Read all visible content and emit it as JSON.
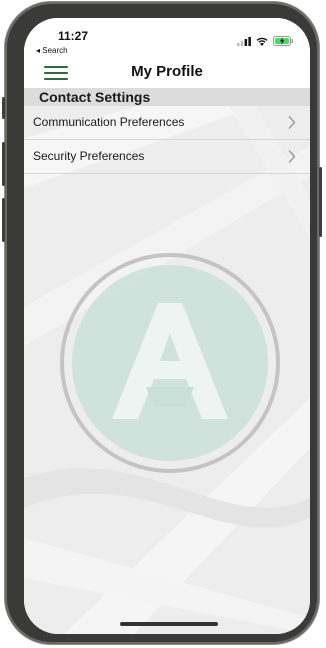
{
  "status_bar": {
    "time": "11:27",
    "back_label": "◂ Search",
    "icons": [
      "signal-icon",
      "wifi-icon",
      "battery-charging-icon"
    ]
  },
  "nav": {
    "title": "My Profile",
    "menu_icon": "hamburger-menu-icon"
  },
  "section": {
    "title": "Contact Settings"
  },
  "items": [
    {
      "label": "Communication Preferences"
    },
    {
      "label": "Security Preferences"
    }
  ],
  "colors": {
    "brand_green": "#2e6b3f",
    "logo_teal": "#c9e0d8",
    "logo_ring": "#c4c4c4",
    "battery_green": "#4cd964"
  }
}
